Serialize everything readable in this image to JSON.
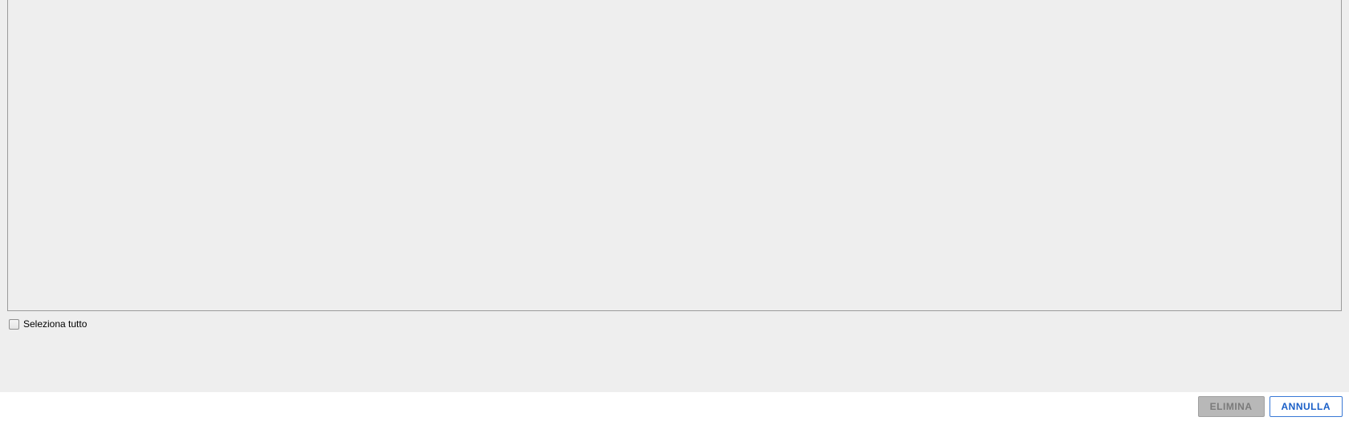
{
  "checkbox": {
    "select_all_label": "Seleziona tutto"
  },
  "footer": {
    "delete_label": "ELIMINA",
    "cancel_label": "ANNULLA"
  }
}
